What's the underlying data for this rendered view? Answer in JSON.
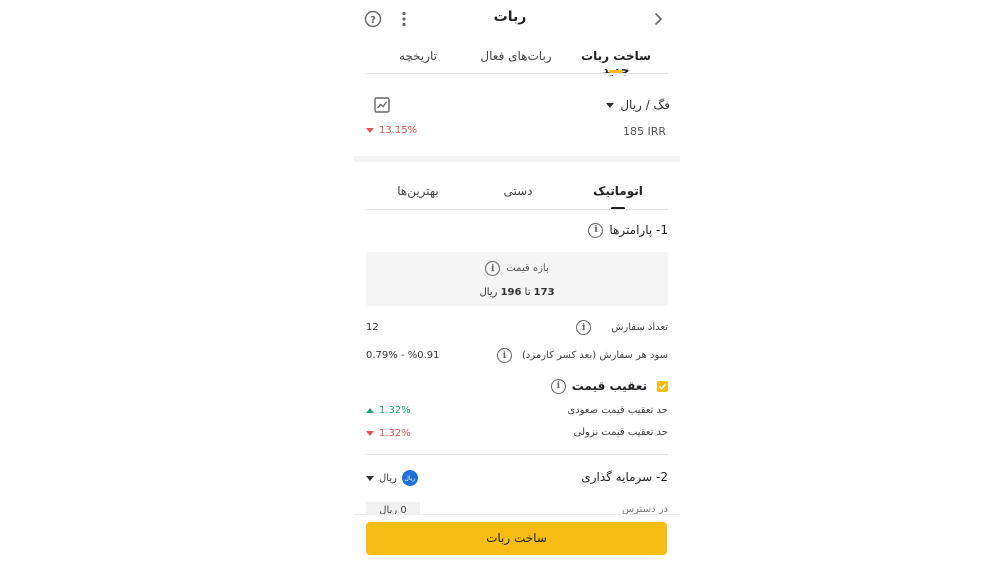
{
  "header": {
    "title": "ربات",
    "back_icon": "chevron-right-icon",
    "help_icon": "question-circle-icon",
    "menu_icon": "more-vertical-icon"
  },
  "top_tabs": [
    {
      "label": "ساخت ربات جدید",
      "active": true
    },
    {
      "label": "ربات‌های فعال",
      "active": false
    },
    {
      "label": "تاریخچه",
      "active": false
    }
  ],
  "market": {
    "pair": "فگ / ریال",
    "price": "185 IRR",
    "change": "13.15%",
    "change_color": "#e35555",
    "chart_icon": "chart-icon"
  },
  "mode_tabs": [
    {
      "label": "اتوماتیک",
      "active": true
    },
    {
      "label": "دستی",
      "active": false
    },
    {
      "label": "بهترین‌ها",
      "active": false
    }
  ],
  "params": {
    "title": "1- پارامترها",
    "price_range": {
      "label": "بازه قیمت",
      "from": "173",
      "sep": "تا",
      "to": "196",
      "unit": "ریال"
    },
    "order_count": {
      "label": "تعداد سفارش",
      "value": "12"
    },
    "profit": {
      "label": "سود هر سفارش (بعد کسر کارمزد)",
      "value": "0.79% - %0.91"
    },
    "trailing": {
      "label": "تعقیب قیمت",
      "checked": true,
      "up_label": "حد تعقیب قیمت صعودی",
      "up_value": "1.32%",
      "up_color": "#26a17b",
      "down_label": "حد تعقیب قیمت نزولی",
      "down_value": "1.32%",
      "down_color": "#e35555"
    }
  },
  "investment": {
    "title": "2- سرمایه گذاری",
    "currency": "ریال",
    "currency_badge": "ریال",
    "available_label": "در دسترس",
    "available_value": "0 ریال"
  },
  "footer": {
    "create_label": "ساخت ربات"
  },
  "colors": {
    "accent": "#f7bd14",
    "panel_bg": "#f5f5f5",
    "badge_blue": "#1e6fd9"
  }
}
